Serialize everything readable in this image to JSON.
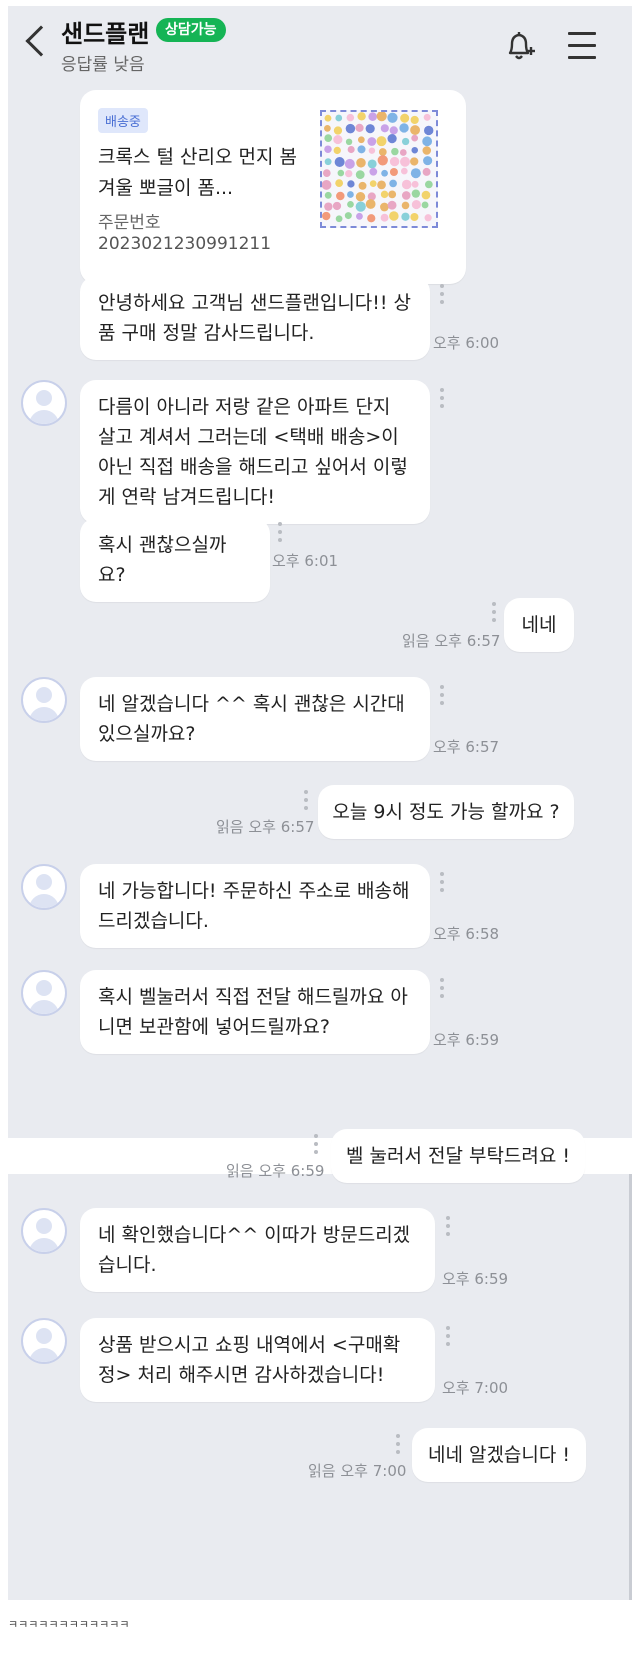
{
  "header": {
    "title": "샌드플랜",
    "badge": "상담가능",
    "subtitle": "응답률 낮음",
    "icons": [
      "back-icon",
      "bell-plus-icon",
      "menu-icon"
    ]
  },
  "product_card": {
    "status": "배송중",
    "name": "크록스 털 산리오 먼지 봄 겨울 뽀글이 폼...",
    "order_label": "주문번호",
    "order_number": "2023021230991211"
  },
  "messages": [
    {
      "side": "in",
      "text": "안녕하세요 고객님 샌드플랜입니다!! 상품 구매 정말 감사드립니다.",
      "time": "오후 6:00"
    },
    {
      "side": "in",
      "text": "다름이 아니라 저랑 같은 아파트 단지 살고 계셔서 그러는데 <택배 배송>이 아닌 직접 배송을 해드리고 싶어서 이렇게 연락 남겨드립니다!",
      "time": ""
    },
    {
      "side": "in",
      "text": "혹시 괜찮으실까요?",
      "time": "오후 6:01"
    },
    {
      "side": "out",
      "text": "네네",
      "time": "읽음 오후 6:57"
    },
    {
      "side": "in",
      "text": "네 알겠습니다 ^^ 혹시 괜찮은 시간대 있으실까요?",
      "time": "오후 6:57"
    },
    {
      "side": "out",
      "text": "오늘 9시 정도 가능 할까요 ?",
      "time": "읽음 오후 6:57"
    },
    {
      "side": "in",
      "text": "네 가능합니다! 주문하신 주소로 배송해드리겠습니다.",
      "time": "오후 6:58"
    },
    {
      "side": "in",
      "text": "혹시 벨눌러서 직접 전달 해드릴까요 아니면 보관함에 넣어드릴까요?",
      "time": "오후 6:59"
    },
    {
      "side": "out",
      "text": "벨 눌러서 전달 부탁드려요 !",
      "time": "읽음 오후 6:59"
    },
    {
      "side": "in",
      "text": "네 확인했습니다^^ 이따가 방문드리겠습니다.",
      "time": "오후 6:59"
    },
    {
      "side": "in",
      "text": "상품 받으시고 쇼핑 내역에서 <구매확정> 처리 해주시면 감사하겠습니다!",
      "time": "오후 7:00"
    },
    {
      "side": "out",
      "text": "네네 알겠습니다 !",
      "time": "읽음 오후 7:00"
    }
  ],
  "caption": "ㅋㅋㅋㅋㅋㅋㅋㅋㅋㅋㅋㅋ",
  "colors": {
    "chat_background": "#e9ebf0",
    "badge_green": "#15b455",
    "status_badge_bg": "#dfe7fb",
    "status_badge_text": "#4a6fd4",
    "bubble": "#ffffff"
  }
}
